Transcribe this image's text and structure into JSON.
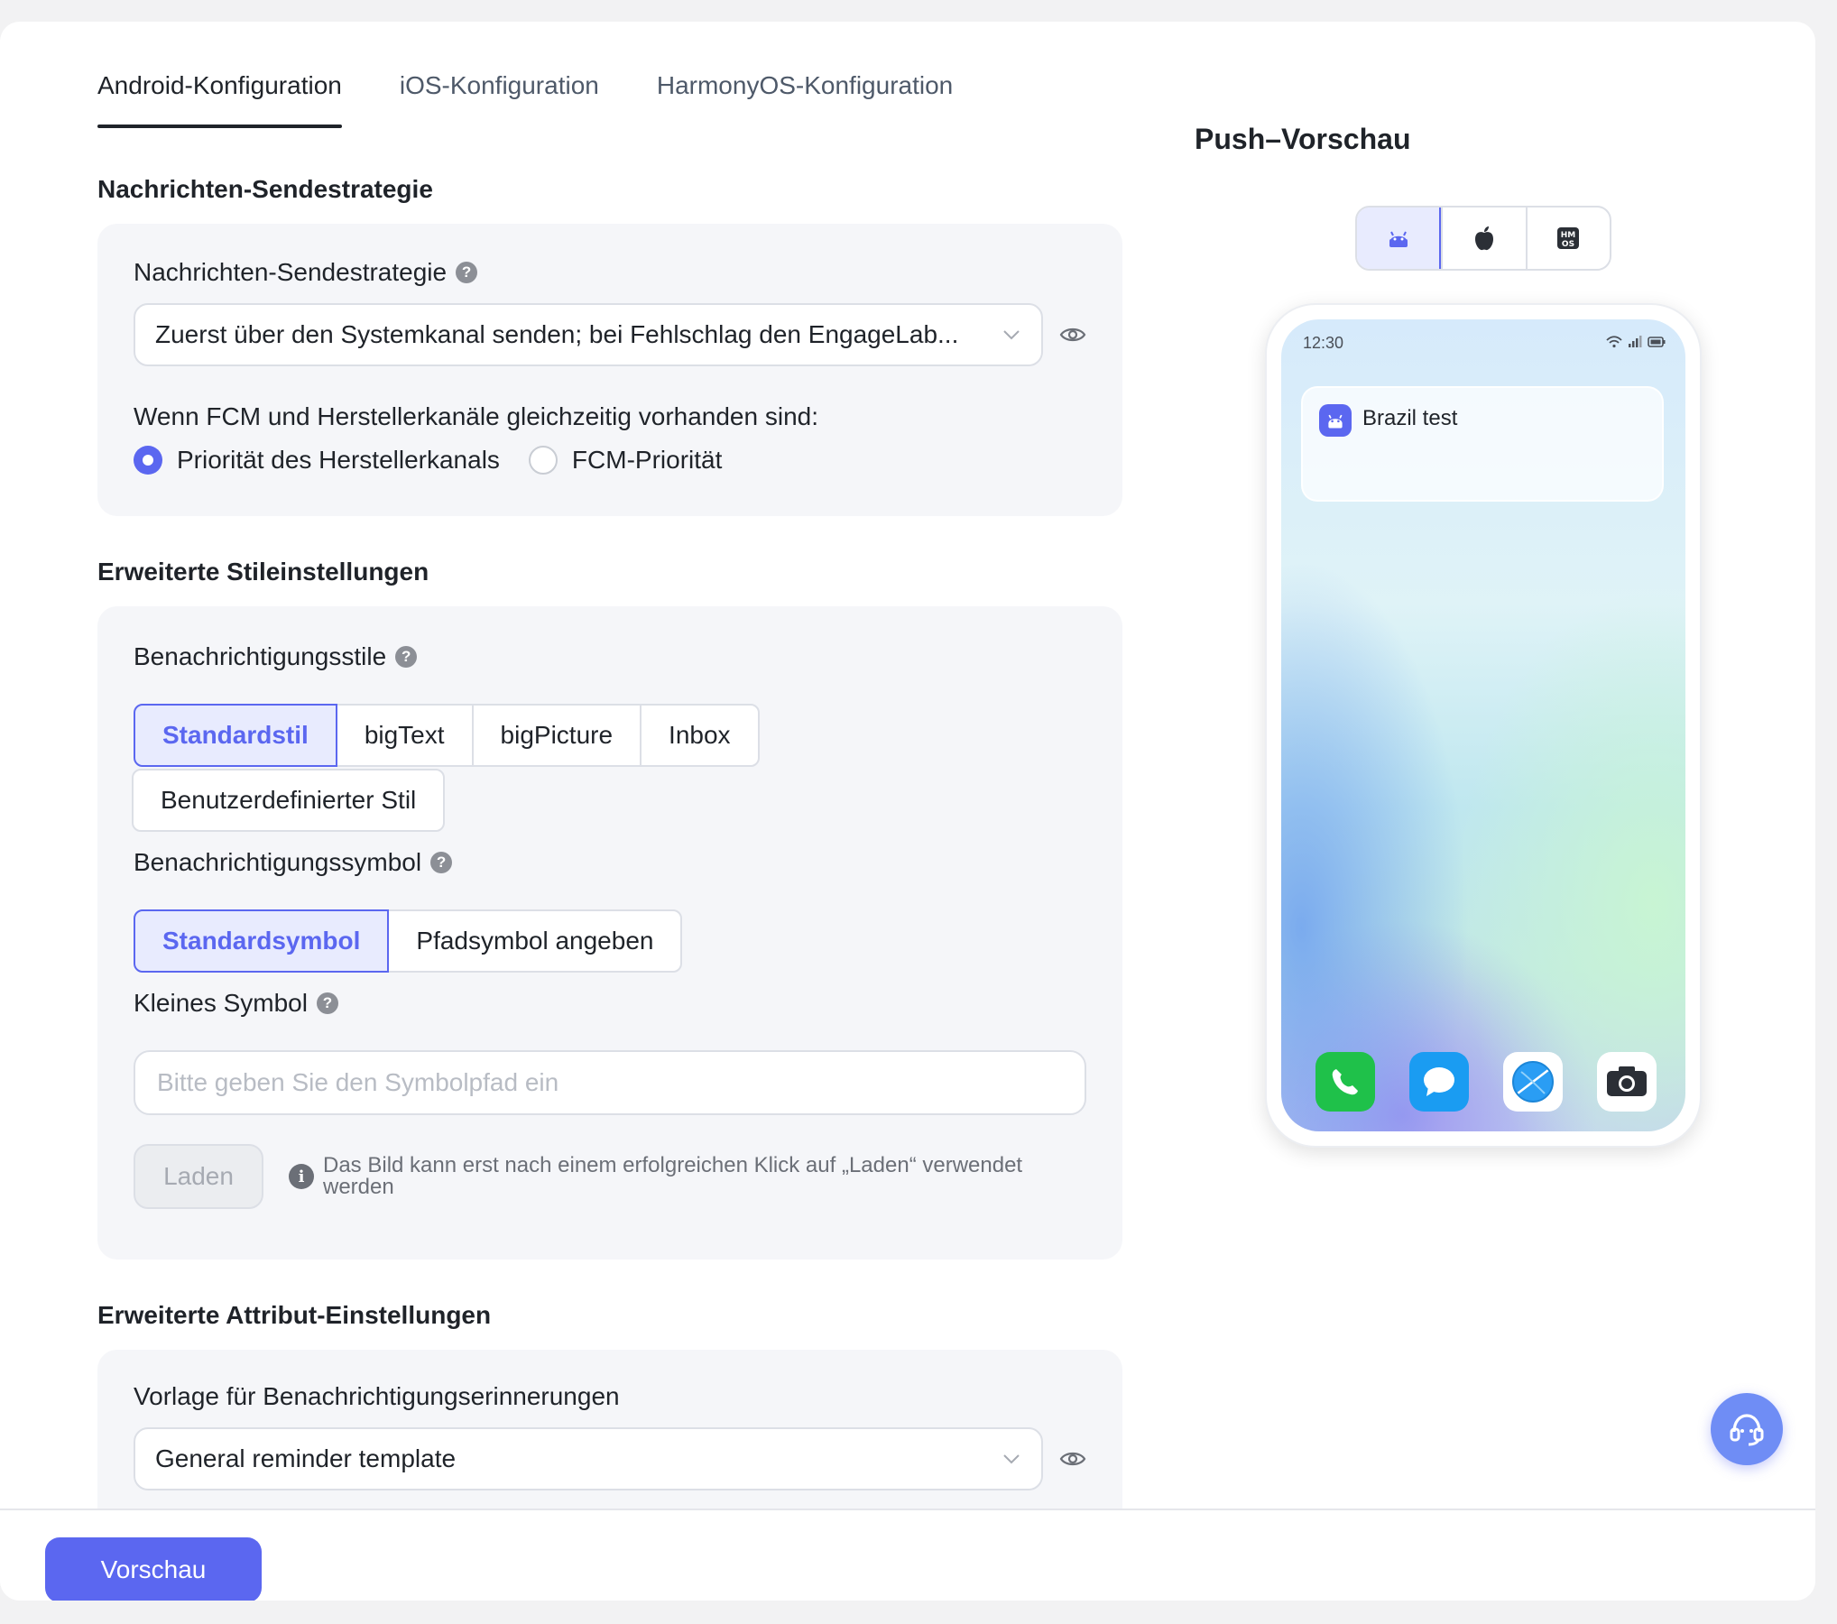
{
  "tabs": [
    {
      "label": "Android-Konfiguration",
      "active": true
    },
    {
      "label": "iOS-Konfiguration",
      "active": false
    },
    {
      "label": "HarmonyOS-Konfiguration",
      "active": false
    }
  ],
  "strategy": {
    "section_title": "Nachrichten-Sendestrategie",
    "field_label": "Nachrichten-Sendestrategie",
    "select_value": "Zuerst über den Systemkanal senden; bei Fehlschlag den EngageLab...",
    "priority_label": "Wenn FCM und Herstellerkanäle gleichzeitig vorhanden sind:",
    "options": [
      {
        "label": "Priorität des Herstellerkanals",
        "checked": true
      },
      {
        "label": "FCM-Priorität",
        "checked": false
      }
    ]
  },
  "style": {
    "section_title": "Erweiterte Stileinstellungen",
    "notification_styles_label": "Benachrichtigungsstile",
    "notification_styles": [
      "Standardstil",
      "bigText",
      "bigPicture",
      "Inbox"
    ],
    "custom_style": "Benutzerdefinierter Stil",
    "icon_label": "Benachrichtigungssymbol",
    "icon_options": [
      "Standardsymbol",
      "Pfadsymbol angeben"
    ],
    "small_icon_label": "Kleines Symbol",
    "small_icon_placeholder": "Bitte geben Sie den Symbolpfad ein",
    "load_button": "Laden",
    "hint_line1": "Das Bild kann erst nach einem erfolgreichen Klick auf „Laden“ verwendet",
    "hint_line2": "werden"
  },
  "attributes": {
    "section_title": "Erweiterte Attribut-Einstellungen",
    "template_label": "Vorlage für Benachrichtigungserinnerungen",
    "template_value": "General reminder template"
  },
  "preview": {
    "title": "Push–Vorschau",
    "os_buttons": [
      {
        "icon": "android-icon",
        "active": true
      },
      {
        "icon": "apple-icon",
        "active": false
      },
      {
        "icon": "harmonyos-icon",
        "active": false
      }
    ],
    "status_time": "12:30",
    "notification_title": "Brazil test",
    "dock_apps": [
      "phone-app-icon",
      "messages-app-icon",
      "browser-app-icon",
      "camera-app-icon"
    ]
  },
  "footer": {
    "preview_button": "Vorschau"
  },
  "colors": {
    "accent": "#5b67f0",
    "accent_bg": "#e8ebfe",
    "panel_bg": "#f5f6f9"
  }
}
